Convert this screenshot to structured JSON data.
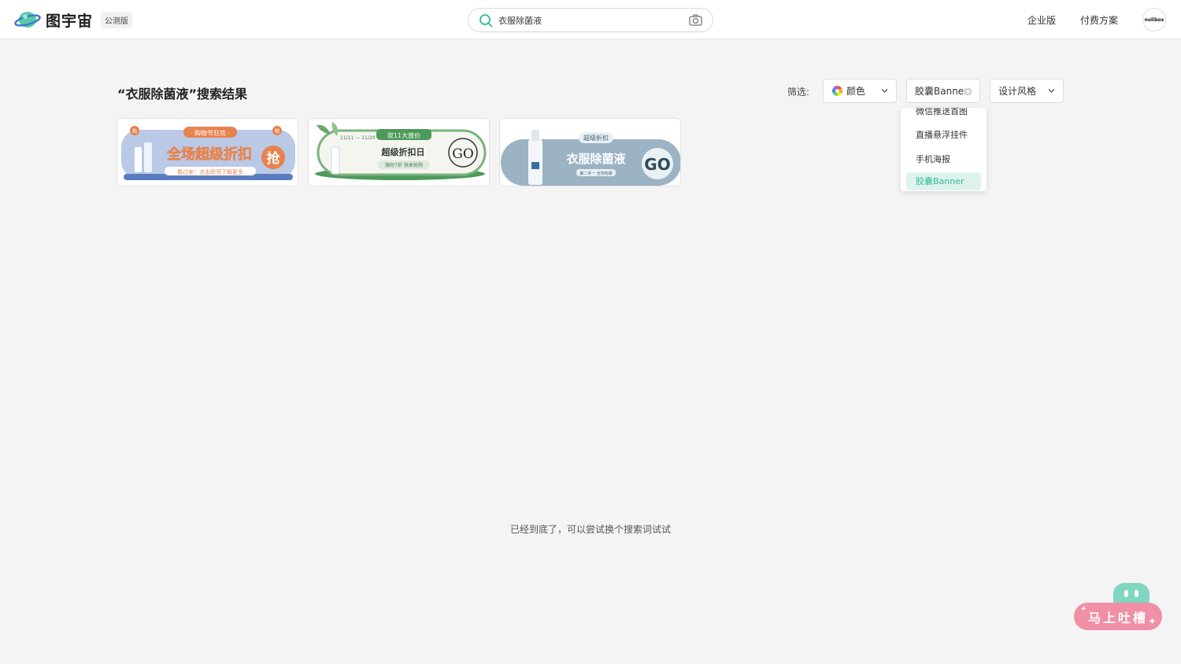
{
  "header": {
    "logo_text": "图宇宙",
    "beta_badge": "公测版",
    "search": {
      "value": "衣服除菌液",
      "placeholder": ""
    },
    "nav": {
      "enterprise": "企业版",
      "pricing": "付费方案"
    },
    "avatar_text": "nolibox"
  },
  "results": {
    "title": "“衣服除菌液”搜索结果",
    "filter_label": "筛选:",
    "filters": {
      "color": "颜色",
      "type": "胶囊Banner",
      "style": "设计风格"
    },
    "dropdown": {
      "items": [
        "微信推送首图",
        "直播悬浮挂件",
        "手机海报",
        "胶囊Banner"
      ],
      "selected": "胶囊Banner"
    },
    "cards": [
      {
        "tag": "· 购物节狂欢 ·",
        "corner_left": "购",
        "corner_right": "物",
        "headline": "全场超级折扣",
        "cta": "抢",
        "subline": "看过来！点击即领了解更多"
      },
      {
        "date": "11/11 — 11/20",
        "tag": "双11大放价",
        "headline": "超级折扣日",
        "subline": "限时7折 快来抢购",
        "cta": "GO"
      },
      {
        "tag": "超级折扣",
        "headline": "衣服除菌液",
        "subline": "第二件一 全场包邮",
        "cta": "GO"
      }
    ],
    "end_message": "已经到底了，可以尝试换个搜索词试试"
  },
  "feedback": {
    "label": "马上吐槽"
  },
  "colors": {
    "accent": "#2dbd9a",
    "selected_bg": "#dff3ee",
    "feedback_pink": "#f08fa5",
    "mascot": "#7fd6c1"
  }
}
